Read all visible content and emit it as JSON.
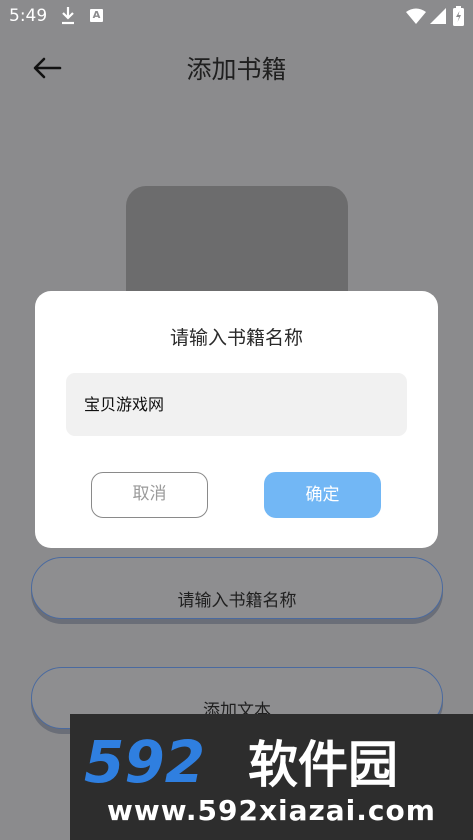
{
  "status_bar": {
    "time": "5:49",
    "notification_badge": "A"
  },
  "header": {
    "title": "添加书籍"
  },
  "buttons": {
    "book_name": "请输入书籍名称",
    "add_text": "添加文本"
  },
  "dialog": {
    "title": "请输入书籍名称",
    "input_value": "宝贝游戏网",
    "cancel_label": "取消",
    "confirm_label": "确定"
  },
  "watermark": {
    "logo_text": "592软件园",
    "url": "www.592xiazai.com"
  },
  "colors": {
    "accent": "#72b7f5",
    "overlay": "#8b8b8d",
    "pill_border": "#4a6aa0",
    "watermark_blue": "#2f7fe0"
  },
  "icons": [
    "download-icon",
    "a-icon",
    "wifi-icon",
    "signal-icon",
    "battery-icon",
    "back-arrow-icon"
  ]
}
